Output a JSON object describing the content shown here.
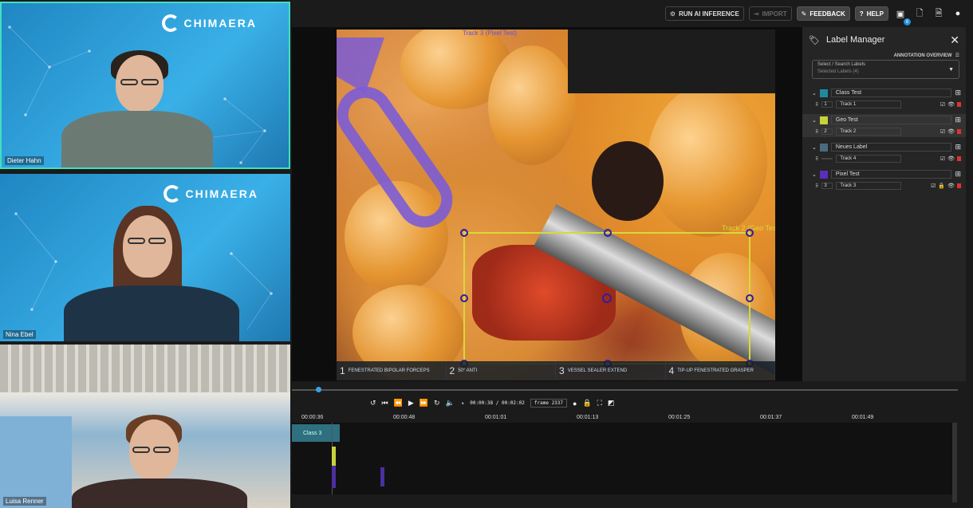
{
  "call": {
    "brand": "CHIMAERA",
    "participants": [
      {
        "name": "Dieter Hahn"
      },
      {
        "name": "Nina Ebel"
      },
      {
        "name": "Luisa Renner"
      }
    ]
  },
  "toolbar": {
    "run_ai": "RUN AI INFERENCE",
    "import": "IMPORT",
    "feedback": "FEEDBACK",
    "help": "HELP",
    "save_badge": "6"
  },
  "video": {
    "top_label": "Track 3 (Pixel Test)",
    "track_label": "Track 2 (Geo Test)",
    "instruments": [
      {
        "num": "1",
        "text": "FENESTRATED BIPOLAR FORCEPS"
      },
      {
        "num": "2",
        "text": "50° ANTI"
      },
      {
        "num": "3",
        "text": "VESSEL SEALER EXTEND"
      },
      {
        "num": "4",
        "text": "TIP-UP FENESTRATED GRASPER"
      }
    ]
  },
  "panel": {
    "title": "Label Manager",
    "overview": "ANNOTATION OVERVIEW",
    "select_label": "Select / Search Labels",
    "select_value": "Selected Labels (4)",
    "labels": [
      {
        "name": "Class Test",
        "color": "#1f8a9e",
        "track_num": "1",
        "track": "Track 1"
      },
      {
        "name": "Geo Test",
        "color": "#c8d23a",
        "track_num": "2",
        "track": "Track 2"
      },
      {
        "name": "Neues Label",
        "color": "#4c6a80",
        "track_num": "",
        "track": "Track 4"
      },
      {
        "name": "Pixel Test",
        "color": "#5a2fb8",
        "track_num": "3",
        "track": "Track 3"
      }
    ]
  },
  "timeline": {
    "current": "00:00:38",
    "total": "00:02:02",
    "frame_label": "frame",
    "frame": "2337",
    "ticks": [
      "00:00:36",
      "00:00:48",
      "00:01:01",
      "00:01:13",
      "00:01:25",
      "00:01:37",
      "00:01:49"
    ],
    "track_chip": "Class 3"
  }
}
